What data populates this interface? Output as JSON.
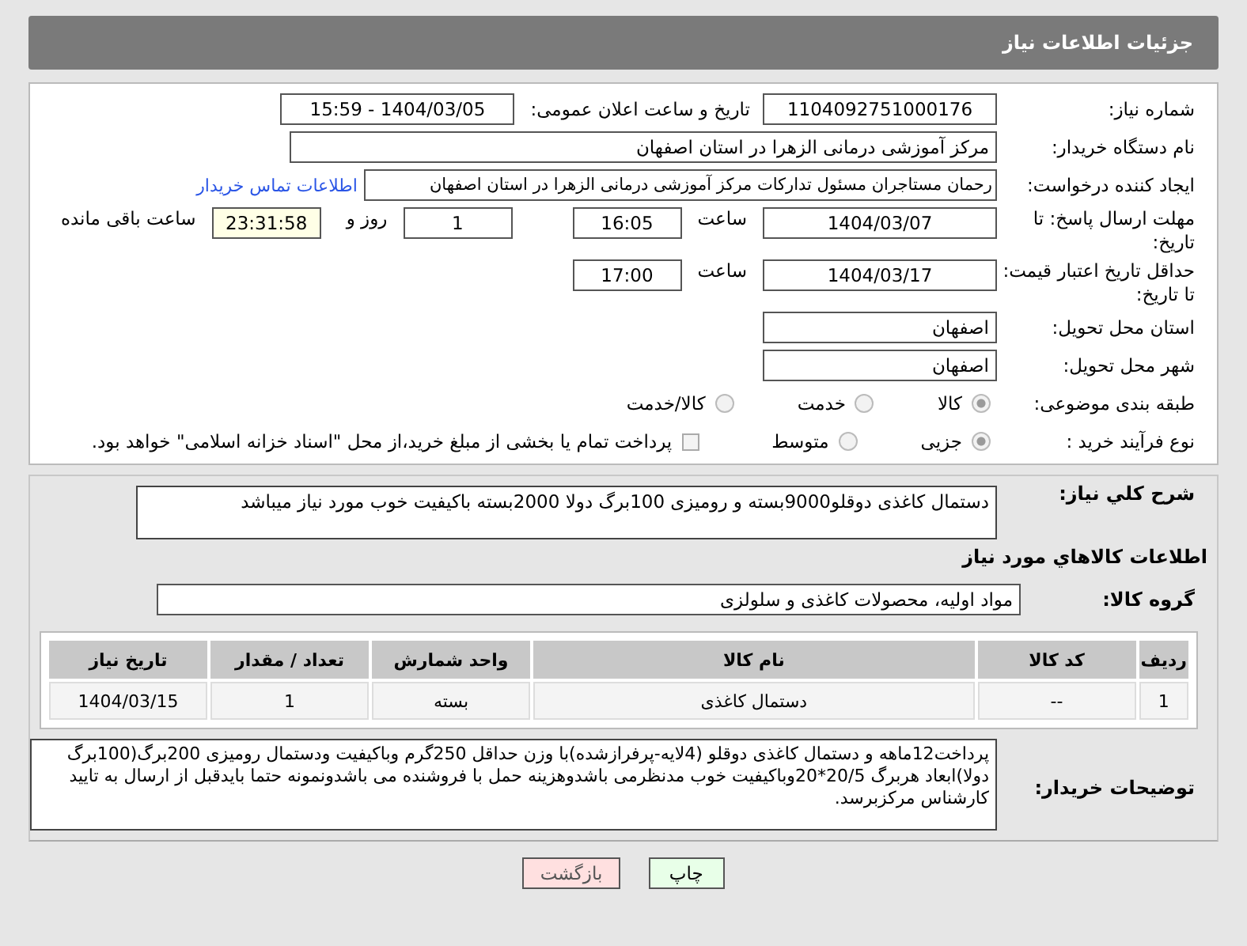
{
  "header": {
    "title": "جزئیات اطلاعات نیاز"
  },
  "need_number": {
    "label": "شماره نیاز:",
    "value": "1104092751000176"
  },
  "announce": {
    "label": "تاریخ و ساعت اعلان عمومی:",
    "value": "1404/03/05 - 15:59"
  },
  "buyer_org": {
    "label": "نام دستگاه خریدار:",
    "value": "مرکز آموزشی درمانی الزهرا در استان اصفهان"
  },
  "requester": {
    "label": "ایجاد کننده درخواست:",
    "value": "رحمان مستاجران مسئول تدارکات مرکز آموزشی درمانی الزهرا در استان اصفهان",
    "link": "اطلاعات تماس خریدار"
  },
  "deadline": {
    "label": "مهلت ارسال پاسخ: تا تاریخ:",
    "date": "1404/03/07",
    "time_label": "ساعت",
    "time": "16:05",
    "days": "1",
    "days_label": "روز و",
    "remaining": "23:31:58",
    "remaining_label": "ساعت باقی مانده"
  },
  "price_validity": {
    "label": "حداقل تاریخ اعتبار قیمت: تا تاریخ:",
    "date": "1404/03/17",
    "time_label": "ساعت",
    "time": "17:00"
  },
  "province": {
    "label": "استان محل تحویل:",
    "value": "اصفهان"
  },
  "city": {
    "label": "شهر محل تحویل:",
    "value": "اصفهان"
  },
  "category": {
    "label": "طبقه بندی موضوعی:",
    "options": [
      {
        "label": "کالا",
        "selected": true
      },
      {
        "label": "خدمت",
        "selected": false
      },
      {
        "label": "کالا/خدمت",
        "selected": false
      }
    ]
  },
  "purchase_type": {
    "label": "نوع فرآیند خرید :",
    "options": [
      {
        "label": "جزیی",
        "selected": true
      },
      {
        "label": "متوسط",
        "selected": false
      }
    ],
    "payment_checkbox": {
      "label": "پرداخت تمام یا بخشی از مبلغ خرید،از محل \"اسناد خزانه اسلامی\" خواهد بود.",
      "checked": false
    }
  },
  "summary": {
    "label": "شرح کلي نياز:",
    "value": "دستمال کاغذی دوقلو9000بسته و رومیزی 100برگ دولا 2000بسته باکیفیت خوب مورد نیاز میباشد"
  },
  "goods_title": "اطلاعات کالاهاي مورد نياز",
  "goods_group": {
    "label": "گروه کالا:",
    "value": "مواد اولیه، محصولات کاغذی و سلولزی"
  },
  "table": {
    "columns": [
      "ردیف",
      "کد کالا",
      "نام کالا",
      "واحد شمارش",
      "تعداد / مقدار",
      "تاریخ نیاز"
    ],
    "rows": [
      [
        "1",
        "--",
        "دستمال کاغذی",
        "بسته",
        "1",
        "1404/03/15"
      ]
    ]
  },
  "buyer_notes": {
    "label": "توضیحات خریدار:",
    "value": "پرداخت12ماهه  و دستمال کاغذی دوقلو (4لایه-پرفرازشده)با وزن حداقل 250گرم وباکیفیت ودستمال رومیزی 200برگ(100برگ دولا)ابعاد هربرگ 20/5*20وباکیفیت خوب مدنظرمی باشدوهزینه حمل با فروشنده می باشدونمونه حتما بایدقبل از ارسال به تایید کارشناس مرکزبرسد."
  },
  "buttons": [
    {
      "kind": "print",
      "label": "چاپ"
    },
    {
      "kind": "back",
      "label": "بازگشت"
    }
  ]
}
